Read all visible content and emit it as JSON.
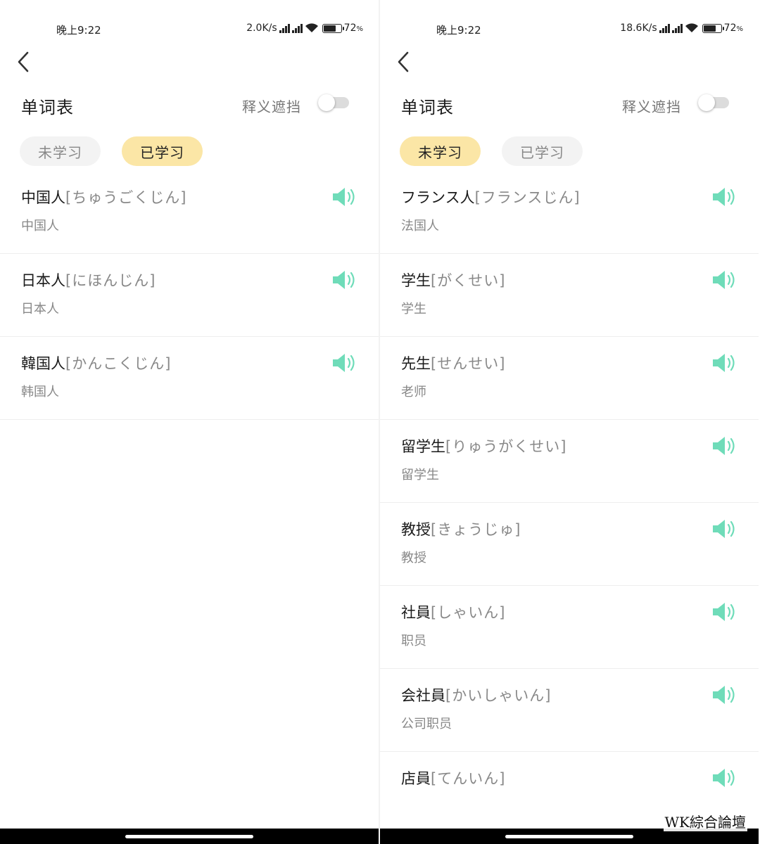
{
  "colors": {
    "accent_tab": "#fbe6a6",
    "speaker": "#6fdcb9",
    "toggle_track": "#dcdcdc"
  },
  "left": {
    "status": {
      "time": "晚上9:22",
      "speed": "2.0K/s",
      "battery": "72",
      "battery_unit": "%"
    },
    "title": "单词表",
    "mask_label": "释义遮挡",
    "mask_on": false,
    "tabs": [
      {
        "label": "未学习",
        "active": false
      },
      {
        "label": "已学习",
        "active": true
      }
    ],
    "words": [
      {
        "kanji": "中国人",
        "kana": "[ちゅうごくじん]",
        "meaning": "中国人"
      },
      {
        "kanji": "日本人",
        "kana": "[にほんじん]",
        "meaning": "日本人"
      },
      {
        "kanji": "韓国人",
        "kana": "[かんこくじん]",
        "meaning": "韩国人"
      }
    ]
  },
  "right": {
    "status": {
      "time": "晚上9:22",
      "speed": "18.6K/s",
      "battery": "72",
      "battery_unit": "%"
    },
    "title": "单词表",
    "mask_label": "释义遮挡",
    "mask_on": false,
    "tabs": [
      {
        "label": "未学习",
        "active": true
      },
      {
        "label": "已学习",
        "active": false
      }
    ],
    "words": [
      {
        "kanji": "フランス人",
        "kana": "[フランスじん]",
        "meaning": "法国人"
      },
      {
        "kanji": "学生",
        "kana": "[がくせい]",
        "meaning": "学生"
      },
      {
        "kanji": "先生",
        "kana": "[せんせい]",
        "meaning": "老师"
      },
      {
        "kanji": "留学生",
        "kana": "[りゅうがくせい]",
        "meaning": "留学生"
      },
      {
        "kanji": "教授",
        "kana": "[きょうじゅ]",
        "meaning": "教授"
      },
      {
        "kanji": "社員",
        "kana": "[しゃいん]",
        "meaning": "职员"
      },
      {
        "kanji": "会社員",
        "kana": "[かいしゃいん]",
        "meaning": "公司职员"
      },
      {
        "kanji": "店員",
        "kana": "[てんいん]",
        "meaning": ""
      }
    ]
  },
  "watermark": "WK綜合論壇"
}
